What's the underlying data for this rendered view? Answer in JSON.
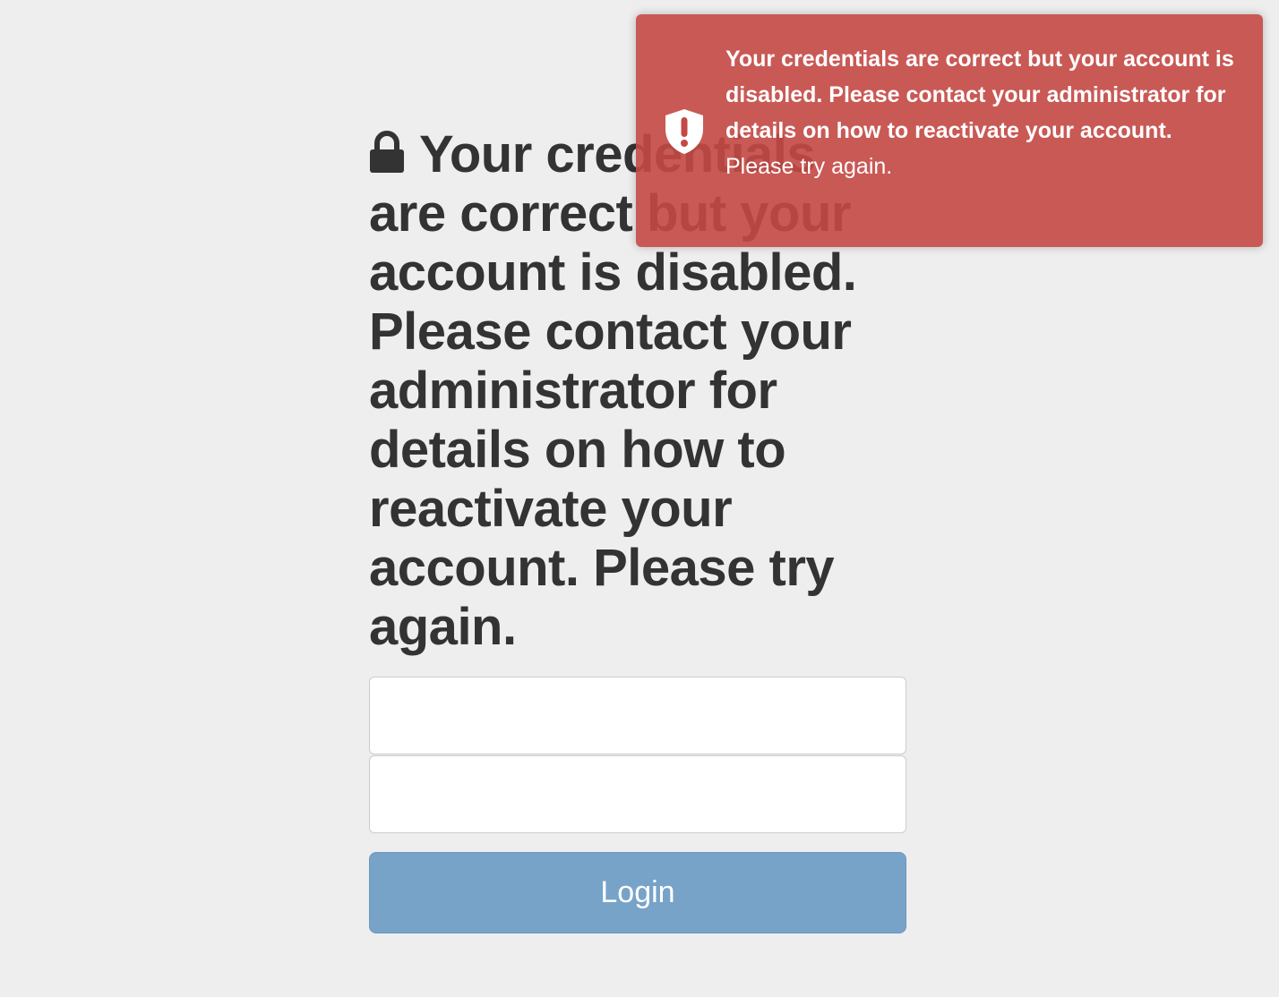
{
  "login": {
    "heading": "Your credentials are correct but your account is disabled. Please contact your administrator for details on how to reactivate your account. Please try again.",
    "lock_icon": "lock-icon",
    "username": {
      "value": "",
      "placeholder": ""
    },
    "password": {
      "value": "",
      "placeholder": ""
    },
    "login_button_label": "Login"
  },
  "toast": {
    "icon": "shield-alert-icon",
    "title": "Your credentials are correct but your account is disabled. Please contact your administrator for details on how to reactivate your account.",
    "message": "Please try again."
  },
  "colors": {
    "background": "#eeeeee",
    "text": "#333333",
    "toast_background": "#c44844",
    "button_background": "#77a3c9"
  }
}
